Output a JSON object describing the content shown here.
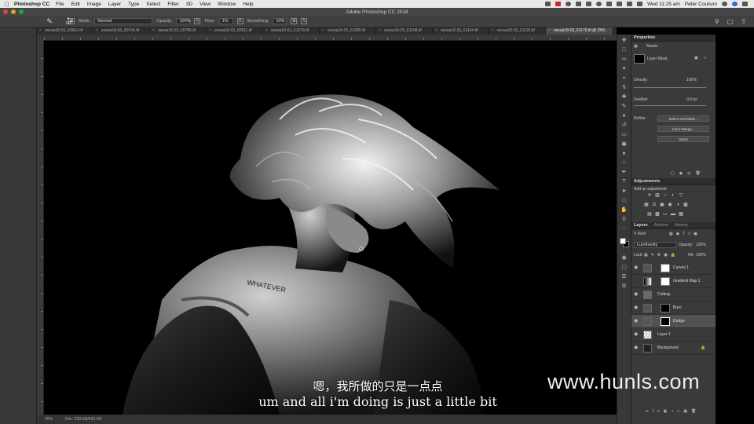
{
  "menubar": {
    "app_name": "Photoshop CC",
    "items": [
      "File",
      "Edit",
      "Image",
      "Layer",
      "Type",
      "Select",
      "Filter",
      "3D",
      "View",
      "Window",
      "Help"
    ],
    "clock": "Wed 11:25 am",
    "user": "Peter Coulson"
  },
  "window": {
    "title": "Adobe Photoshop CC 2018"
  },
  "options": {
    "brush_size": "60",
    "mode_label": "Mode:",
    "mode_value": "Normal",
    "opacity_label": "Opacity:",
    "opacity_value": "100%",
    "flow_label": "Flow:",
    "flow_value": "1%",
    "smoothing_label": "Smoothing:",
    "smoothing_value": "10%"
  },
  "tabs": [
    "essua18-03_60661.tif",
    "essua18-03_60704.tif",
    "essua18-03_60786.tif",
    "essua18-03_60911.tif",
    "essua18-03_61079.tif",
    "essua18-03_61085.tif",
    "essua18-03_61108.tif",
    "essua18-03_61144.tif",
    "essua18-03_61125.tif",
    "essua18-03_61179.tif @ 25%"
  ],
  "status": {
    "zoom": "25%",
    "doc": "Doc: 293.5M/433.2M"
  },
  "properties": {
    "title": "Properties",
    "section": "Masks",
    "mask_type": "Layer Mask",
    "density_label": "Density:",
    "density_value": "100%",
    "feather_label": "Feather:",
    "feather_value": "0.0 px",
    "refine_label": "Refine:",
    "btn_select_mask": "Select and Mask...",
    "btn_color_range": "Color Range...",
    "btn_invert": "Invert"
  },
  "adjustments": {
    "title": "Adjustments",
    "hint": "Add an adjustment"
  },
  "layers_panel": {
    "tabs": [
      "Layers",
      "Actions",
      "History"
    ],
    "kind": "Kind",
    "blend_mode": "Luminosity",
    "opacity_label": "Opacity:",
    "opacity_value": "100%",
    "lock_label": "Lock:",
    "fill_label": "Fill:",
    "fill_value": "100%",
    "layers": [
      {
        "name": "Curves 1"
      },
      {
        "name": "Gradient Map 1"
      },
      {
        "name": "Cutting"
      },
      {
        "name": "Burn"
      },
      {
        "name": "Dodge"
      },
      {
        "name": "Layer 1"
      },
      {
        "name": "Background"
      }
    ]
  },
  "subtitles": {
    "zh": "嗯，我所做的只是一点点",
    "en": "um and all i'm doing is just a little bit"
  },
  "watermark": "www.hunls.com",
  "tattoo": "WHATEVER"
}
